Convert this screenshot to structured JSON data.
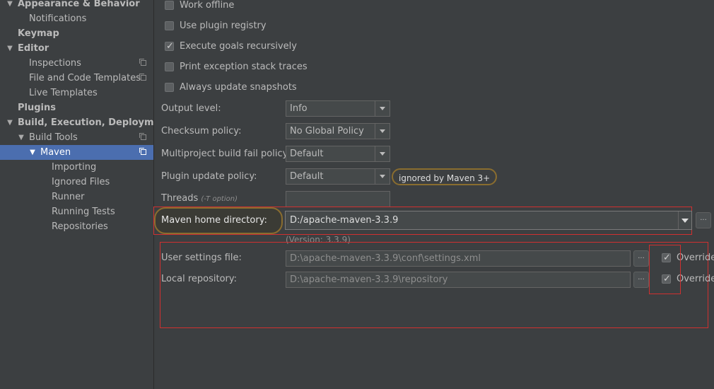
{
  "sidebar": {
    "items": [
      {
        "label": "Appearance & Behavior",
        "bold": true,
        "arrow": "▼"
      },
      {
        "label": "Notifications"
      },
      {
        "label": "Keymap",
        "bold": true
      },
      {
        "label": "Editor",
        "bold": true,
        "arrow": "▼"
      },
      {
        "label": "Inspections",
        "icon": "project-copy-icon"
      },
      {
        "label": "File and Code Templates",
        "icon": "project-copy-icon"
      },
      {
        "label": "Live Templates"
      },
      {
        "label": "Plugins",
        "bold": true
      },
      {
        "label": "Build, Execution, Deployment",
        "bold": true,
        "arrow": "▼"
      },
      {
        "label": "Build Tools",
        "arrow": "▼",
        "icon": "project-copy-icon"
      },
      {
        "label": "Maven",
        "arrow": "▼",
        "icon": "project-copy-icon",
        "selected": true
      },
      {
        "label": "Importing"
      },
      {
        "label": "Ignored Files"
      },
      {
        "label": "Runner"
      },
      {
        "label": "Running Tests"
      },
      {
        "label": "Repositories"
      }
    ]
  },
  "maven": {
    "checkboxes": [
      {
        "label": "Work offline",
        "checked": false
      },
      {
        "label": "Use plugin registry",
        "checked": false
      },
      {
        "label": "Execute goals recursively",
        "checked": true
      },
      {
        "label": "Print exception stack traces",
        "checked": false
      },
      {
        "label": "Always update snapshots",
        "checked": false
      }
    ],
    "output_level": {
      "label": "Output level:",
      "value": "Info"
    },
    "checksum_policy": {
      "label": "Checksum policy:",
      "value": "No Global Policy"
    },
    "multiproject_fail_policy": {
      "label": "Multiproject build fail policy:",
      "value": "Default"
    },
    "plugin_update_policy": {
      "label": "Plugin update policy:",
      "value": "Default",
      "badge": "ignored by Maven 3+"
    },
    "threads": {
      "label": "Threads",
      "hint": "(-T option)",
      "value": ""
    },
    "home_directory": {
      "label": "Maven home directory:",
      "value": "D:/apache-maven-3.3.9",
      "version": "(Version: 3.3.9)"
    },
    "user_settings": {
      "label": "User settings file:",
      "value": "D:\\apache-maven-3.3.9\\conf\\settings.xml",
      "override_label": "Override",
      "override": true
    },
    "local_repository": {
      "label": "Local repository:",
      "value": "D:\\apache-maven-3.3.9\\repository",
      "override_label": "Override",
      "override": true
    },
    "browse_label": "..."
  },
  "colors": {
    "accent_selection": "#4b6eaf",
    "highlight_box": "#d03030",
    "badge_border": "#8a6d2f"
  }
}
